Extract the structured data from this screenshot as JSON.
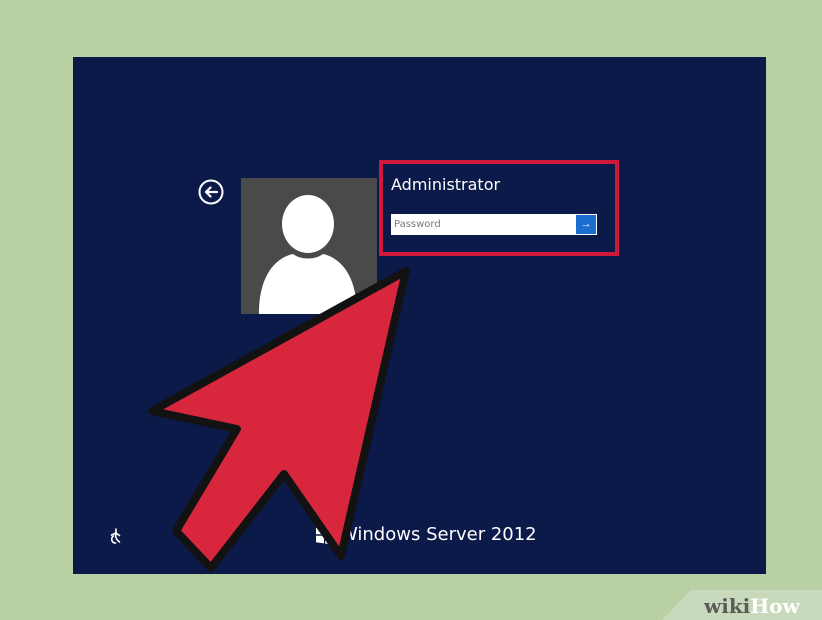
{
  "login": {
    "username": "Administrator",
    "password_placeholder": "Password",
    "submit_symbol": "→"
  },
  "footer": {
    "product_name": "Windows Server 2012"
  },
  "icons": {
    "back": "back-arrow-icon",
    "user": "user-icon",
    "submit": "arrow-right-icon",
    "ease_of_access": "ease-of-access-icon",
    "windows_logo": "windows-logo-icon"
  },
  "watermark": {
    "part1": "wiki",
    "part2": "How"
  },
  "colors": {
    "background": "#0b1a49",
    "frame": "#b8d0a4",
    "highlight": "#d0193a",
    "submit": "#1a6fd0",
    "avatar_tile": "#4a4a4a"
  }
}
